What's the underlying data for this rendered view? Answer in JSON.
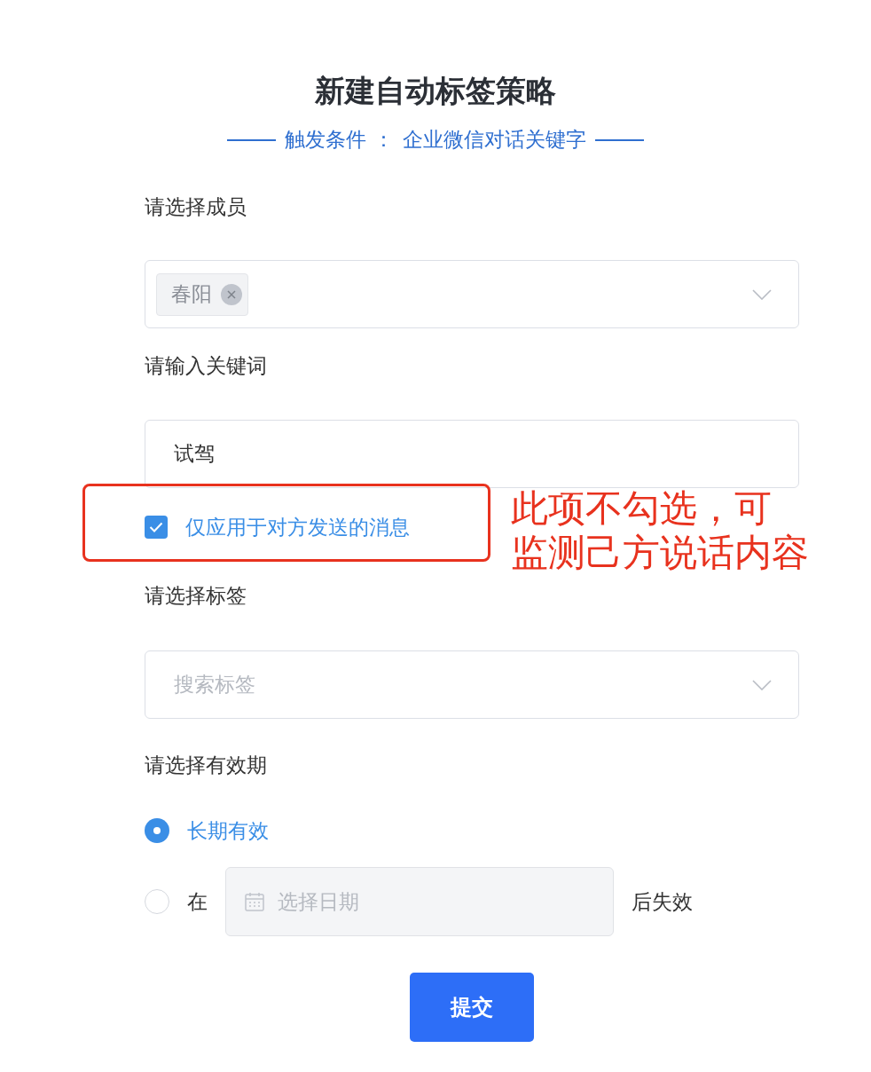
{
  "title": "新建自动标签策略",
  "subtitle": {
    "label": "触发条件 ：",
    "value": "企业微信对话关键字"
  },
  "members": {
    "label": "请选择成员",
    "tags": [
      {
        "text": "春阳"
      }
    ]
  },
  "keyword": {
    "label": "请输入关键词",
    "value": "试驾"
  },
  "only_incoming": {
    "label": "仅应用于对方发送的消息",
    "checked": true
  },
  "tags_select": {
    "label": "请选择标签",
    "placeholder": "搜索标签"
  },
  "validity": {
    "label": "请选择有效期",
    "options": [
      {
        "kind": "text",
        "label": "长期有效",
        "selected": true
      },
      {
        "kind": "date",
        "prefix": "在",
        "placeholder": "选择日期",
        "suffix": "后失效",
        "selected": false
      }
    ]
  },
  "submit": "提交",
  "annotation": {
    "lines": [
      "此项不勾选，可",
      "监测己方说话内容"
    ]
  }
}
